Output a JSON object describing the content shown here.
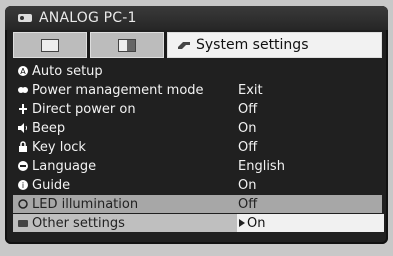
{
  "window": {
    "title": "ANALOG PC-1"
  },
  "tabs": [
    {
      "icon": "blank-page-icon"
    },
    {
      "icon": "half-page-icon"
    },
    {
      "icon": "gear-icon",
      "label": "System settings"
    }
  ],
  "rows": [
    {
      "icon": "auto-setup-icon",
      "label": "Auto setup",
      "value": ""
    },
    {
      "icon": "power-management-icon",
      "label": "Power management mode",
      "value": "Exit"
    },
    {
      "icon": "direct-power-icon",
      "label": "Direct power on",
      "value": "Off"
    },
    {
      "icon": "beep-icon",
      "label": "Beep",
      "value": "On"
    },
    {
      "icon": "lock-icon",
      "label": "Key lock",
      "value": "Off"
    },
    {
      "icon": "language-icon",
      "label": "Language",
      "value": "English"
    },
    {
      "icon": "guide-icon",
      "label": "Guide",
      "value": "On"
    },
    {
      "icon": "led-icon",
      "label": "LED illumination",
      "value": "Off"
    },
    {
      "icon": "other-settings-icon",
      "label": "Other settings",
      "value": "On"
    }
  ],
  "colors": {
    "screen_bg": "#202020",
    "selected_row": "#bfbfbf",
    "selected_value_bg": "#f1f1f1"
  }
}
